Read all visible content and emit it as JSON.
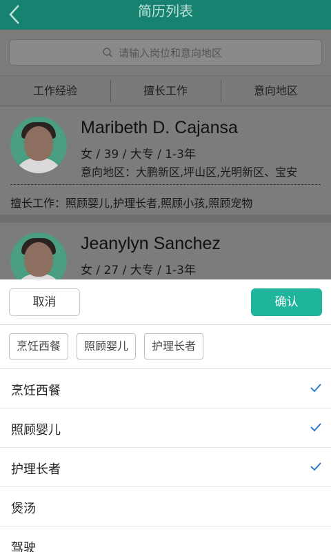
{
  "header": {
    "title": "简历列表"
  },
  "search": {
    "placeholder": "请输入岗位和意向地区"
  },
  "filters": [
    "工作经验",
    "擅长工作",
    "意向地区"
  ],
  "resumes": [
    {
      "name": "Maribeth D. Cajansa",
      "meta": "女 / 39 / 大专 / 1-3年",
      "area": "意向地区：大鹏新区,坪山区,光明新区、宝安",
      "skills": "擅长工作：照顾婴儿,护理长者,照顾小孩,照顾宠物"
    },
    {
      "name": "Jeanylyn Sanchez",
      "meta": "女 / 27 / 大专 / 1-3年"
    }
  ],
  "sheet": {
    "cancel_label": "取消",
    "confirm_label": "确认",
    "selected_chips": [
      "烹饪西餐",
      "照顾婴儿",
      "护理长者"
    ],
    "options": [
      {
        "label": "烹饪西餐",
        "checked": true
      },
      {
        "label": "照顾婴儿",
        "checked": true
      },
      {
        "label": "护理长者",
        "checked": true
      },
      {
        "label": "煲汤",
        "checked": false
      },
      {
        "label": "驾驶",
        "checked": false
      }
    ]
  },
  "colors": {
    "header": "#17826f",
    "accent": "#1fb59d",
    "check": "#1a6fc4"
  },
  "icons": {
    "back": "chevron-left-icon",
    "search": "search-icon",
    "check": "check-icon"
  }
}
